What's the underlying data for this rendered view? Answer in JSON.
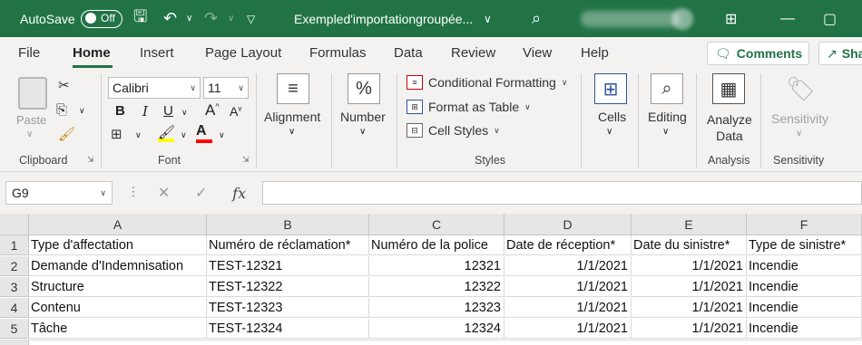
{
  "titlebar": {
    "autosave_label": "AutoSave",
    "autosave_state": "Off",
    "doc_title": "Exempled'importationgroupée...",
    "icons": [
      "save-icon",
      "undo-icon",
      "redo-icon",
      "customize-qat-icon",
      "search-icon",
      "ribbon-display-icon",
      "minimize-icon",
      "maximize-icon"
    ]
  },
  "tabs": [
    "File",
    "Home",
    "Insert",
    "Page Layout",
    "Formulas",
    "Data",
    "Review",
    "View",
    "Help"
  ],
  "active_tab": "Home",
  "comments_label": "Comments",
  "share_label": "Sha",
  "ribbon": {
    "clipboard": {
      "paste_label": "Paste",
      "group_label": "Clipboard"
    },
    "font": {
      "font_name": "Calibri",
      "font_size": "11",
      "group_label": "Font",
      "bold": "B",
      "italic": "I",
      "underline": "U",
      "grow": "A",
      "shrink": "A",
      "font_color_letter": "A"
    },
    "alignment": {
      "label": "Alignment"
    },
    "number": {
      "label": "Number",
      "glyph": "%"
    },
    "styles": {
      "conditional_formatting": "Conditional Formatting",
      "format_as_table": "Format as Table",
      "cell_styles": "Cell Styles",
      "group_label": "Styles"
    },
    "cells": {
      "label": "Cells"
    },
    "editing": {
      "label": "Editing"
    },
    "analysis": {
      "analyze_line1": "Analyze",
      "analyze_line2": "Data",
      "group_label": "Analysis"
    },
    "sensitivity": {
      "button_label": "Sensitivity",
      "group_label": "Sensitivity"
    },
    "accent_colors": {
      "highlight": "#ffff00",
      "font_color": "#ff0000",
      "brand": "#217346"
    }
  },
  "formula_bar": {
    "name_box": "G9",
    "formula": "",
    "fx_label": "fx"
  },
  "sheet": {
    "columns": [
      "A",
      "B",
      "C",
      "D",
      "E",
      "F"
    ],
    "row_numbers": [
      "1",
      "2",
      "3",
      "4",
      "5"
    ],
    "rows": [
      [
        "Type d'affectation",
        "Numéro de réclamation*",
        "Numéro de la police",
        "Date de réception*",
        "Date du sinistre*",
        "Type de sinistre*"
      ],
      [
        "Demande d'Indemnisation",
        "TEST-12321",
        "12321",
        "1/1/2021",
        "1/1/2021",
        "Incendie"
      ],
      [
        "Structure",
        "TEST-12322",
        "12322",
        "1/1/2021",
        "1/1/2021",
        "Incendie"
      ],
      [
        "Contenu",
        "TEST-12323",
        "12323",
        "1/1/2021",
        "1/1/2021",
        "Incendie"
      ],
      [
        "Tâche",
        "TEST-12324",
        "12324",
        "1/1/2021",
        "1/1/2021",
        "Incendie"
      ]
    ]
  }
}
